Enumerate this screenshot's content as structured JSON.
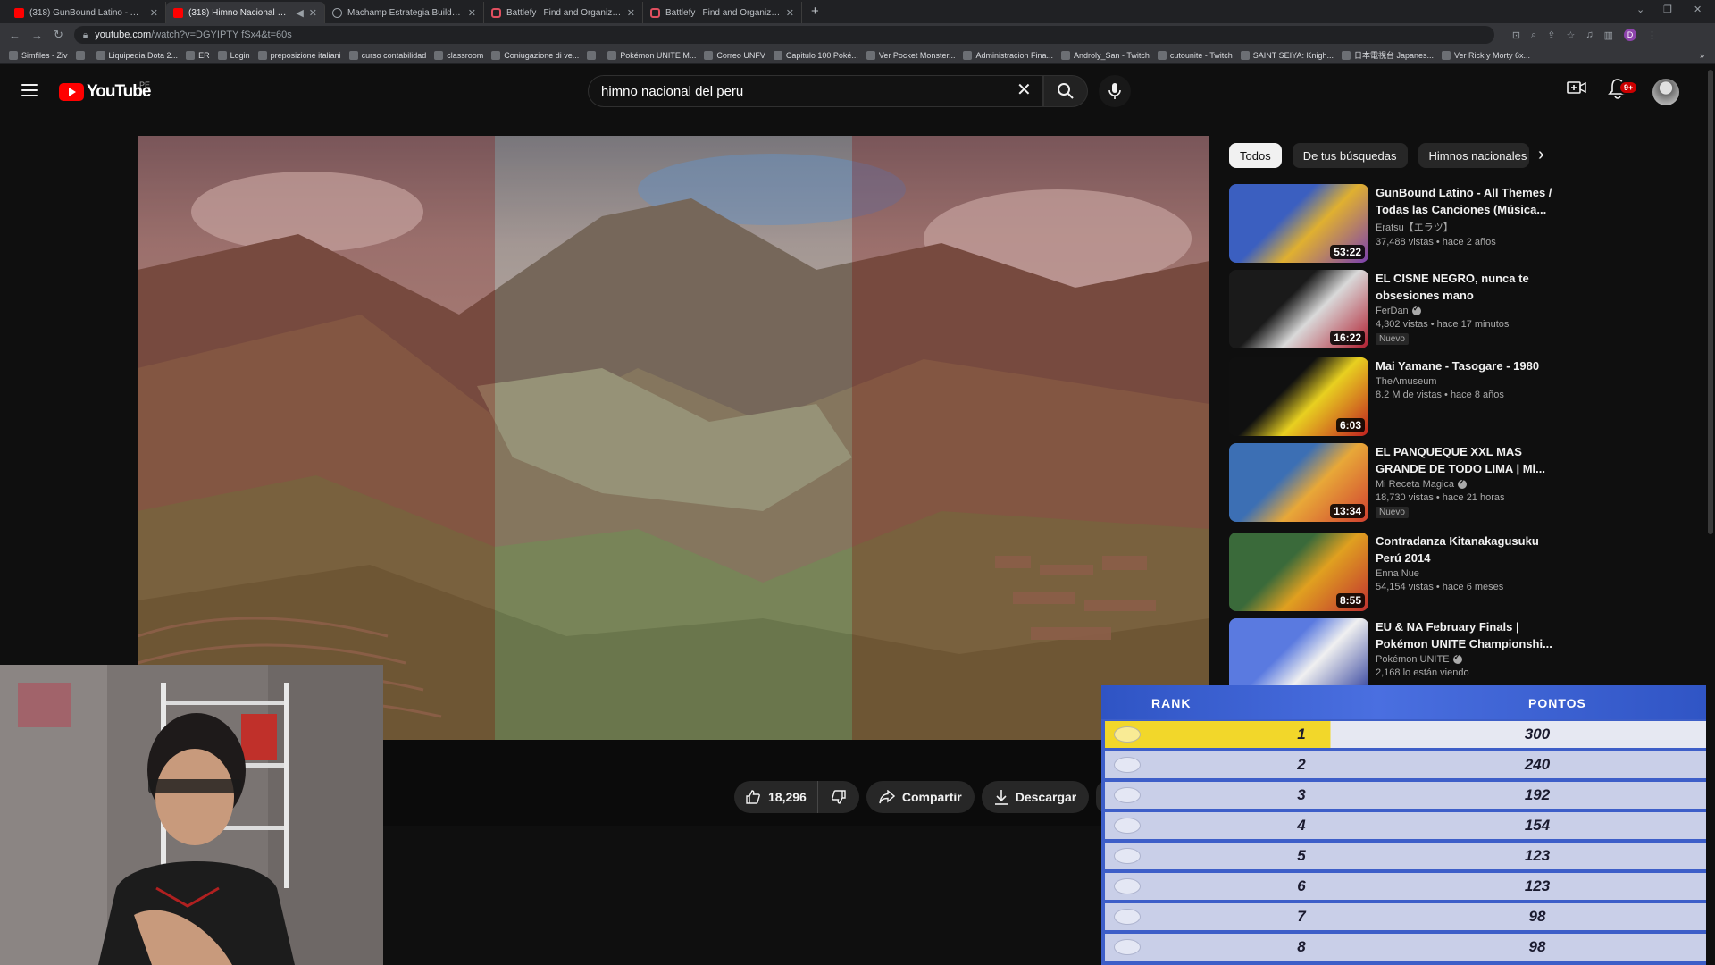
{
  "browser": {
    "tabs": [
      {
        "title": "(318) GunBound Latino - All Then",
        "icon": "youtube-icon",
        "active": false
      },
      {
        "title": "(318) Himno Nacional del Pe",
        "icon": "youtube-icon",
        "active": true
      },
      {
        "title": "Machamp Estrategia Builds - Pok",
        "icon": "machamp-site-icon",
        "active": false
      },
      {
        "title": "Battlefy | Find and Organize Esp",
        "icon": "battlefy-icon",
        "active": false
      },
      {
        "title": "Battlefy | Find and Organize Esp",
        "icon": "battlefy-icon",
        "active": false
      }
    ],
    "new_tab": "+",
    "url_host": "youtube.com",
    "url_path": "/watch?v=DGYIPTY fSx4&t=60s",
    "profile_letter": "D",
    "bookmarks": [
      "Simfiles - Ziv",
      "",
      "Liquipedia Dota 2...",
      "ER",
      "Login",
      "preposizione italiani",
      "curso contabilidad",
      "classroom",
      "Coniugazione di ve...",
      "",
      "Pokémon UNITE M...",
      "Correo UNFV",
      "Capitulo 100 Poké...",
      "Ver Pocket Monster...",
      "Administracion Fina...",
      "Androly_San - Twitch",
      "cutounite - Twitch",
      "SAINT SEIYA: Knigh...",
      "日本電視台 Japanes...",
      "Ver Rick y Morty 6x..."
    ],
    "bookmarks_more": "»"
  },
  "masthead": {
    "logo_text": "YouTube",
    "country": "PE",
    "search_query": "himno nacional del peru",
    "notif_count": "9+"
  },
  "actions": {
    "likes": "18,296",
    "share": "Compartir",
    "download": "Descargar"
  },
  "chips": [
    "Todos",
    "De tus búsquedas",
    "Himnos nacionales"
  ],
  "recommendations": [
    {
      "title": "GunBound Latino - All Themes / Todas las Canciones (Música...",
      "channel": "Eratsu【エラツ】",
      "verified": false,
      "stats": "37,488 vistas • hace 2 años",
      "duration": "53:22",
      "badge": "",
      "thumb_colors": [
        "#3b5fc0",
        "#e0b030",
        "#7a3fb0"
      ]
    },
    {
      "title": "EL CISNE NEGRO, nunca te obsesiones mano",
      "channel": "FerDan",
      "verified": true,
      "stats": "4,302 vistas • hace 17 minutos",
      "duration": "16:22",
      "badge": "Nuevo",
      "thumb_colors": [
        "#1a1a1a",
        "#d9d9d9",
        "#b01c2e"
      ]
    },
    {
      "title": "Mai Yamane - Tasogare - 1980",
      "channel": "TheAmuseum",
      "verified": false,
      "stats": "8.2 M de vistas • hace 8 años",
      "duration": "6:03",
      "badge": "",
      "thumb_colors": [
        "#101010",
        "#e8d020",
        "#c02020"
      ]
    },
    {
      "title": "EL PANQUEQUE XXL MAS GRANDE DE TODO LIMA | Mi...",
      "channel": "Mi Receta Magica",
      "verified": true,
      "stats": "18,730 vistas • hace 21 horas",
      "duration": "13:34",
      "badge": "Nuevo",
      "thumb_colors": [
        "#3c6fb4",
        "#e8a838",
        "#d04030"
      ]
    },
    {
      "title": "Contradanza Kitanakagusuku Perú 2014",
      "channel": "Enna Nue",
      "verified": false,
      "stats": "54,154 vistas • hace 6 meses",
      "duration": "8:55",
      "badge": "",
      "thumb_colors": [
        "#3a6a3a",
        "#e0a020",
        "#c03030"
      ]
    },
    {
      "title": "EU & NA February Finals | Pokémon UNITE Championshi...",
      "channel": "Pokémon UNITE",
      "verified": true,
      "stats": "2,168 lo están viendo",
      "duration": "",
      "badge": "",
      "thumb_colors": [
        "#5a7ae0",
        "#f0f0f0",
        "#2a3a9a"
      ]
    }
  ],
  "scoreboard": {
    "rank_header": "RANK",
    "points_header": "PONTOS",
    "rows": [
      {
        "rank": "1",
        "points": "300"
      },
      {
        "rank": "2",
        "points": "240"
      },
      {
        "rank": "3",
        "points": "192"
      },
      {
        "rank": "4",
        "points": "154"
      },
      {
        "rank": "5",
        "points": "123"
      },
      {
        "rank": "6",
        "points": "123"
      },
      {
        "rank": "7",
        "points": "98"
      },
      {
        "rank": "8",
        "points": "98"
      }
    ]
  },
  "colors": {
    "yt_red": "#ff0000",
    "yt_bg": "#0f0f0f",
    "scoreboard_blue": "#3d5ec8",
    "first_place_gold": "#f2d72a",
    "flag_red": "#962828"
  }
}
